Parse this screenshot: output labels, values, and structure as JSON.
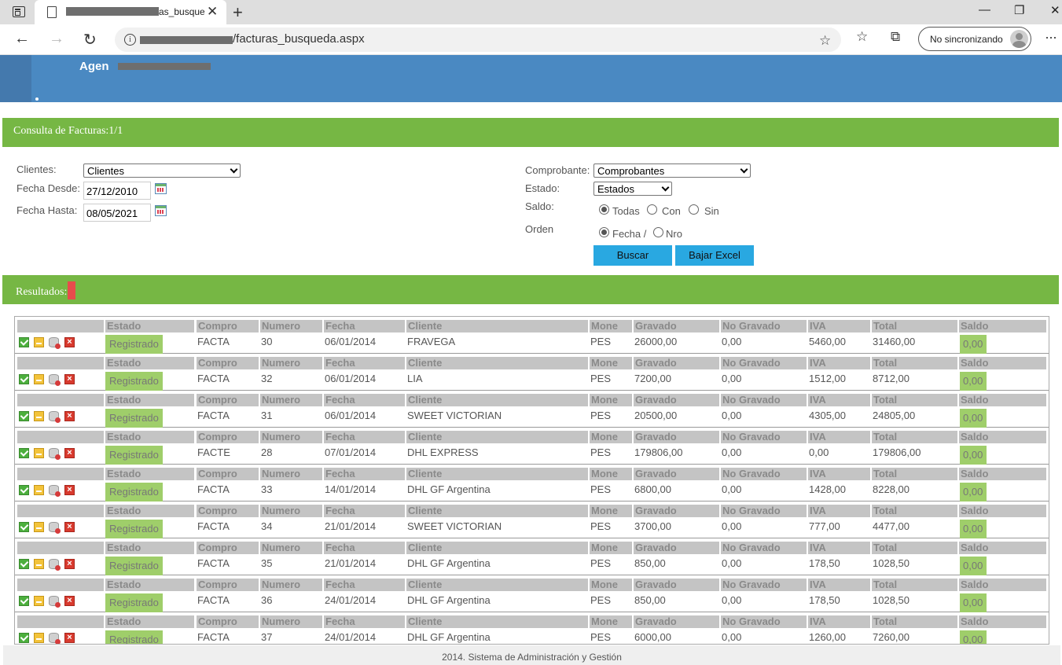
{
  "browser": {
    "tab_title_suffix": "as_busque",
    "tab_close": "✕",
    "new_tab": "+",
    "url_path": "/facturas_busqueda.aspx",
    "sync_label": "No sincronizando",
    "minimize": "—",
    "maximize": "❐",
    "close": "✕",
    "back": "←",
    "forward": "→",
    "refresh": "↻",
    "info_icon": "i",
    "more": "···"
  },
  "header": {
    "brand": "Agen"
  },
  "consulta_bar": {
    "title": "Consulta de Facturas:1/1"
  },
  "filters": {
    "clientes_label": "Clientes:",
    "clientes_value": "Clientes",
    "fecha_desde_label": "Fecha Desde:",
    "fecha_desde_value": "27/12/2010",
    "fecha_hasta_label": "Fecha Hasta:",
    "fecha_hasta_value": "08/05/2021",
    "comprobante_label": "Comprobante:",
    "comprobante_value": "Comprobantes",
    "estado_label": "Estado:",
    "estado_value": "Estados",
    "saldo_label": "Saldo:",
    "saldo_options": [
      "Todas",
      "Con",
      "Sin"
    ],
    "saldo_selected": "Todas",
    "orden_label": "Orden",
    "orden_options": [
      "Fecha /",
      "Nro"
    ],
    "orden_selected": "Fecha /",
    "buscar_label": "Buscar",
    "excel_label": "Bajar Excel"
  },
  "results_bar": {
    "title": "Resultados:"
  },
  "columns": [
    "Estado",
    "Compro",
    "Numero",
    "Fecha",
    "Cliente",
    "Mone",
    "Gravado",
    "No Gravado",
    "IVA",
    "Total",
    "Saldo"
  ],
  "rows": [
    {
      "estado": "Registrado",
      "compro": "FACTA",
      "numero": "30",
      "fecha": "06/01/2014",
      "cliente": "FRAVEGA",
      "mone": "PES",
      "gravado": "26000,00",
      "no_gravado": "0,00",
      "iva": "5460,00",
      "total": "31460,00",
      "saldo": "0,00"
    },
    {
      "estado": "Registrado",
      "compro": "FACTA",
      "numero": "32",
      "fecha": "06/01/2014",
      "cliente": "LIA",
      "mone": "PES",
      "gravado": "7200,00",
      "no_gravado": "0,00",
      "iva": "1512,00",
      "total": "8712,00",
      "saldo": "0,00"
    },
    {
      "estado": "Registrado",
      "compro": "FACTA",
      "numero": "31",
      "fecha": "06/01/2014",
      "cliente": "SWEET VICTORIAN",
      "mone": "PES",
      "gravado": "20500,00",
      "no_gravado": "0,00",
      "iva": "4305,00",
      "total": "24805,00",
      "saldo": "0,00"
    },
    {
      "estado": "Registrado",
      "compro": "FACTE",
      "numero": "28",
      "fecha": "07/01/2014",
      "cliente": "DHL EXPRESS",
      "mone": "PES",
      "gravado": "179806,00",
      "no_gravado": "0,00",
      "iva": "0,00",
      "total": "179806,00",
      "saldo": "0,00"
    },
    {
      "estado": "Registrado",
      "compro": "FACTA",
      "numero": "33",
      "fecha": "14/01/2014",
      "cliente": "DHL GF Argentina",
      "mone": "PES",
      "gravado": "6800,00",
      "no_gravado": "0,00",
      "iva": "1428,00",
      "total": "8228,00",
      "saldo": "0,00"
    },
    {
      "estado": "Registrado",
      "compro": "FACTA",
      "numero": "34",
      "fecha": "21/01/2014",
      "cliente": "SWEET VICTORIAN",
      "mone": "PES",
      "gravado": "3700,00",
      "no_gravado": "0,00",
      "iva": "777,00",
      "total": "4477,00",
      "saldo": "0,00"
    },
    {
      "estado": "Registrado",
      "compro": "FACTA",
      "numero": "35",
      "fecha": "21/01/2014",
      "cliente": "DHL GF Argentina",
      "mone": "PES",
      "gravado": "850,00",
      "no_gravado": "0,00",
      "iva": "178,50",
      "total": "1028,50",
      "saldo": "0,00"
    },
    {
      "estado": "Registrado",
      "compro": "FACTA",
      "numero": "36",
      "fecha": "24/01/2014",
      "cliente": "DHL GF Argentina",
      "mone": "PES",
      "gravado": "850,00",
      "no_gravado": "0,00",
      "iva": "178,50",
      "total": "1028,50",
      "saldo": "0,00"
    },
    {
      "estado": "Registrado",
      "compro": "FACTA",
      "numero": "37",
      "fecha": "24/01/2014",
      "cliente": "DHL GF Argentina",
      "mone": "PES",
      "gravado": "6000,00",
      "no_gravado": "0,00",
      "iva": "1260,00",
      "total": "7260,00",
      "saldo": "0,00"
    }
  ],
  "row_actions": [
    "check-icon",
    "document-icon",
    "database-remove-icon",
    "delete-icon"
  ],
  "footer": {
    "text": "2014. Sistema de Administración y Gestión"
  },
  "colors": {
    "header_blue": "#4a89c2",
    "bar_green": "#76b744",
    "button_blue": "#29a8e1",
    "badge_green": "#9fce6a"
  }
}
